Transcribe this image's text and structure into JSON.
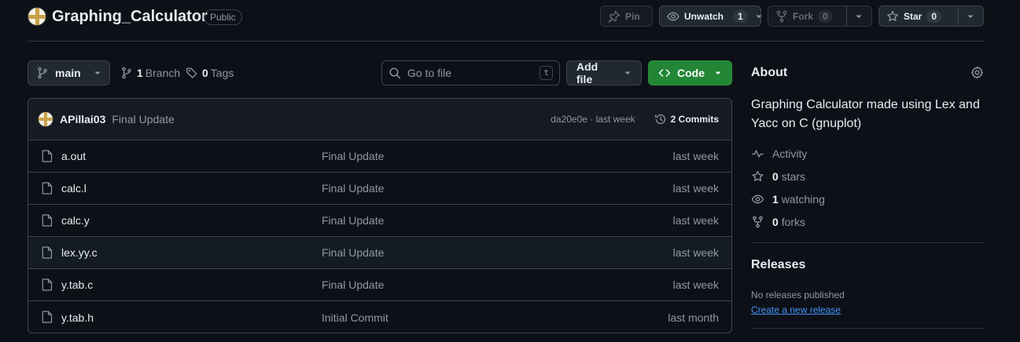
{
  "repo": {
    "name": "Graphing_Calculator",
    "visibility": "Public"
  },
  "header_actions": {
    "pin": "Pin",
    "watch": "Unwatch",
    "watch_count": "1",
    "fork": "Fork",
    "fork_count": "0",
    "star": "Star",
    "star_count": "0"
  },
  "toolbar": {
    "branch": "main",
    "branch_count": "1",
    "branch_label": "Branch",
    "tag_count": "0",
    "tag_label": "Tags",
    "search_placeholder": "Go to file",
    "search_shortcut": "t",
    "add_file": "Add file",
    "code": "Code"
  },
  "latest_commit": {
    "author": "APillai03",
    "message": "Final Update",
    "sha_time": "da20e0e · last week",
    "commits": "2 Commits"
  },
  "files": [
    {
      "name": "a.out",
      "message": "Final Update",
      "date": "last week"
    },
    {
      "name": "calc.l",
      "message": "Final Update",
      "date": "last week"
    },
    {
      "name": "calc.y",
      "message": "Final Update",
      "date": "last week"
    },
    {
      "name": "lex.yy.c",
      "message": "Final Update",
      "date": "last week"
    },
    {
      "name": "y.tab.c",
      "message": "Final Update",
      "date": "last week"
    },
    {
      "name": "y.tab.h",
      "message": "Initial Commit",
      "date": "last month"
    }
  ],
  "about": {
    "heading": "About",
    "description": "Graphing Calculator made using Lex and Yacc on C (gnuplot)",
    "activity": "Activity",
    "stars_count": "0",
    "stars_label": "stars",
    "watching_count": "1",
    "watching_label": "watching",
    "forks_count": "0",
    "forks_label": "forks"
  },
  "releases": {
    "heading": "Releases",
    "none_text": "No releases published",
    "create_link": "Create a new release"
  }
}
